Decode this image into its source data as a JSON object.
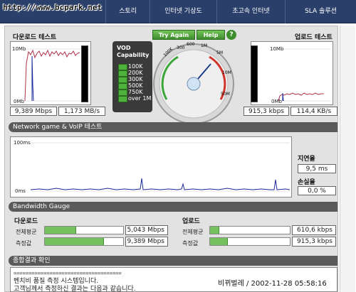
{
  "nav": {
    "url_watermark": "http://www.bcpark.net",
    "items": [
      "스토리",
      "인터넷 기상도",
      "초고속 인터넷",
      "SLA 솔루션"
    ]
  },
  "download_test": {
    "title": "다운로드 테스트",
    "scale_top": "10Mb",
    "scale_bottom": "0Mb",
    "speed_mbps": "9,389 Mbps",
    "speed_mbs": "1,173 MB/s"
  },
  "upload_test": {
    "title": "업로드 테스트",
    "scale_top": "10Mb",
    "scale_bottom": "0Mb",
    "speed_kbps": "915,3 kbps",
    "speed_kbs": "114,4 KB/s"
  },
  "vod": {
    "title_line1": "VOD",
    "title_line2": "Capability",
    "levels": [
      "100K",
      "200K",
      "300K",
      "500K",
      "750K",
      "over 1M"
    ]
  },
  "gauge": {
    "try_again": "Try Again",
    "help": "Help",
    "help_icon": "?",
    "ticks": [
      "100K",
      "300",
      "600",
      "1M",
      "5M",
      "10M",
      "50M"
    ]
  },
  "network": {
    "title": "Network game & VoIP 테스트",
    "scale_top": "100ms",
    "scale_bottom": "0ms",
    "latency_label": "지연율",
    "latency_value": "9,5 ms",
    "loss_label": "손실율",
    "loss_value": "0,0 %"
  },
  "bandwidth": {
    "title": "Bandwidth Gauge",
    "download": {
      "title": "다운로드",
      "avg_label": "전체평균",
      "avg_value": "5,043 Mbps",
      "avg_fill": 0.4,
      "measured_label": "측정값",
      "measured_value": "9,389 Mbps",
      "measured_fill": 0.75
    },
    "upload": {
      "title": "업로드",
      "avg_label": "전체평균",
      "avg_value": "610,6 kbps",
      "avg_fill": 0.12,
      "measured_label": "측정값",
      "measured_value": "915,3 kbps",
      "measured_fill": 0.22
    }
  },
  "summary": {
    "title": "종합결과 확인",
    "line_sep": "====================================",
    "line1": "벤치비 품질 측정 시스템입니다.",
    "line2": "고객님께서 측정하신 결과는 다음과 같습니다."
  },
  "overlay_caption": "비뀌벌레 / 2002-11-28 05:58:16",
  "colors": {
    "nav_bg": "#2a3f6a",
    "graph_line": "#b0304a",
    "graph_line_blue": "#1b2a9a",
    "accent_green": "#4fb23c"
  }
}
